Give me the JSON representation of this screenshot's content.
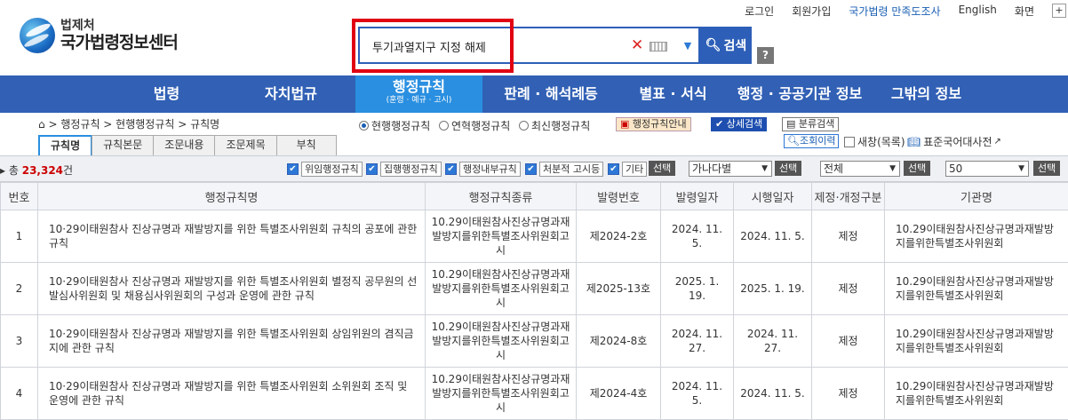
{
  "logo": {
    "small": "법제처",
    "big": "국가법령정보센터"
  },
  "toplinks": [
    "로그인",
    "회원가입",
    "국가법령 만족도조사",
    "English",
    "화면"
  ],
  "search": {
    "value": "투기과열지구 지정 해제",
    "button": "검색",
    "help": "?"
  },
  "nav": [
    {
      "label": "법령"
    },
    {
      "label": "자치법규"
    },
    {
      "label": "행정규칙",
      "sub": "(훈령 · 예규 · 고시)"
    },
    {
      "label": "판례 · 해석례등"
    },
    {
      "label": "별표 · 서식"
    },
    {
      "label": "행정 · 공공기관 정보"
    },
    {
      "label": "그밖의 정보"
    }
  ],
  "breadcrumb": "> 행정규칙 > 현행행정규칙 > 규칙명",
  "radios": [
    "현행행정규칙",
    "연혁행정규칙",
    "최신행정규칙"
  ],
  "buttons": {
    "guide": "행정규칙안내",
    "detail": "상세검색",
    "category": "분류검색",
    "history": "조회이력",
    "new_window": "새창(목록)",
    "dictionary": "표준국어대사전"
  },
  "tabs": [
    "규칙명",
    "규칙본문",
    "조문내용",
    "조문제목",
    "부칙"
  ],
  "filters": {
    "total_prefix": "총",
    "total_count": "23,324",
    "total_suffix": "건",
    "checks": [
      "위임행정규칙",
      "집행행정규칙",
      "행정내부규칙",
      "처분적 고시등",
      "기타"
    ],
    "select_label": "선택",
    "sort": "가나다별",
    "scope": "전체",
    "page_size": "50"
  },
  "table": {
    "headers": [
      "번호",
      "행정규칙명",
      "행정규칙종류",
      "발령번호",
      "발령일자",
      "시행일자",
      "제정·개정구분",
      "기관명"
    ],
    "rows": [
      [
        "1",
        "10·29이태원참사 진상규명과 재발방지를 위한 특별조사위원회 규칙의 공포에 관한 규칙",
        "10.29이태원참사진상규명과재발방지를위한특별조사위원회고시",
        "제2024-2호",
        "2024. 11. 5.",
        "2024. 11. 5.",
        "제정",
        "10.29이태원참사진상규명과재발방지를위한특별조사위원회"
      ],
      [
        "2",
        "10·29이태원참사 진상규명과 재발방지를 위한 특별조사위원회 별정직 공무원의 선발심사위원회 및 채용심사위원회의 구성과 운영에 관한 규칙",
        "10.29이태원참사진상규명과재발방지를위한특별조사위원회고시",
        "제2025-13호",
        "2025. 1. 19.",
        "2025. 1. 19.",
        "제정",
        "10.29이태원참사진상규명과재발방지를위한특별조사위원회"
      ],
      [
        "3",
        "10·29이태원참사 진상규명과 재발방지를 위한 특별조사위원회 상임위원의 겸직금지에 관한 규칙",
        "10.29이태원참사진상규명과재발방지를위한특별조사위원회고시",
        "제2024-8호",
        "2024. 11. 27.",
        "2024. 11. 27.",
        "제정",
        "10.29이태원참사진상규명과재발방지를위한특별조사위원회"
      ],
      [
        "4",
        "10·29이태원참사 진상규명과 재발방지를 위한 특별조사위원회 소위원회 조직 및 운영에 관한 규칙",
        "10.29이태원참사진상규명과재발방지를위한특별조사위원회고시",
        "제2024-4호",
        "2024. 11. 5.",
        "2024. 11. 5.",
        "제정",
        "10.29이태원참사진상규명과재발방지를위한특별조사위원회"
      ]
    ]
  }
}
